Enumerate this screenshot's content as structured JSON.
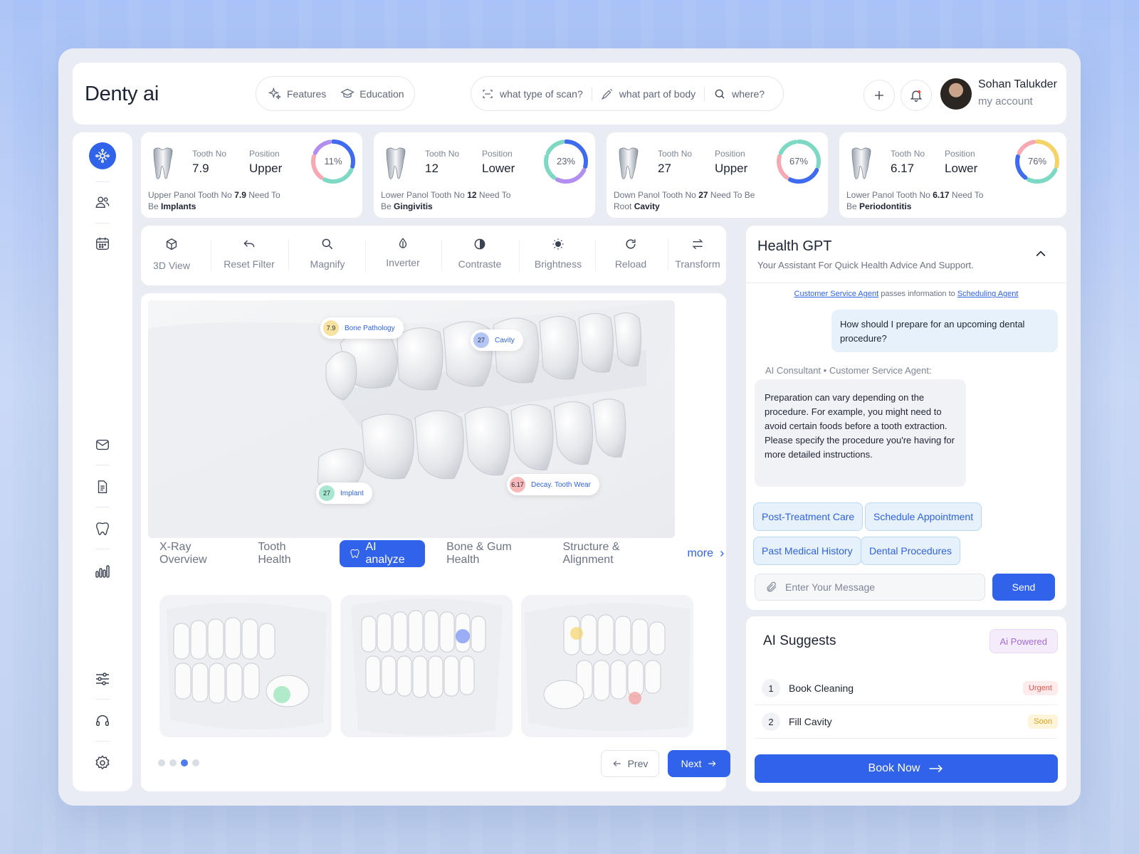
{
  "app": {
    "title": "Denty ai"
  },
  "header": {
    "nav": [
      {
        "label": "Features",
        "icon": "sparkles-icon"
      },
      {
        "label": "Education",
        "icon": "graduation-cap-icon"
      }
    ],
    "search": [
      {
        "label": "what type of scan?",
        "icon": "scan-icon"
      },
      {
        "label": "what part of body",
        "icon": "syringe-icon"
      },
      {
        "label": "where?",
        "icon": "search-icon"
      }
    ],
    "user": {
      "name": "Sohan Talukder",
      "subtitle": "my account"
    }
  },
  "tooth_cards": [
    {
      "tooth_label": "Tooth No",
      "tooth_no": "7.9",
      "position_label": "Position",
      "position": "Upper",
      "percent_text": "11%",
      "percent": 11,
      "desc_prefix": "Upper Panol Tooth No",
      "desc_num": "7.9",
      "desc_mid": "Need To Be",
      "desc_cond": "Implants",
      "ring_colors": [
        "#3f6bf0",
        "#7dd9c3",
        "#f7a8b3",
        "#b28ef0"
      ]
    },
    {
      "tooth_label": "Tooth No",
      "tooth_no": "12",
      "position_label": "Position",
      "position": "Lower",
      "percent_text": "23%",
      "percent": 23,
      "desc_prefix": "Lower Panol Tooth No",
      "desc_num": "12",
      "desc_mid": "Need To Be",
      "desc_cond": "Gingivitis",
      "ring_colors": [
        "#3f6bf0",
        "#b28ef0",
        "#7dd9c3",
        "#7dd9c3"
      ]
    },
    {
      "tooth_label": "Tooth No",
      "tooth_no": "27",
      "position_label": "Position",
      "position": "Upper",
      "percent_text": "67%",
      "percent": 67,
      "desc_prefix": "Down Panol Tooth No",
      "desc_num": "27",
      "desc_mid": "Need To Be Root",
      "desc_cond": "Cavity",
      "ring_colors": [
        "#7dd9c3",
        "#3f6bf0",
        "#f7a8b3",
        "#7dd9c3"
      ]
    },
    {
      "tooth_label": "Tooth No",
      "tooth_no": "6.17",
      "position_label": "Position",
      "position": "Lower",
      "percent_text": "76%",
      "percent": 76,
      "desc_prefix": "Lower Panol Tooth No",
      "desc_num": "6.17",
      "desc_mid": "Need To Be",
      "desc_cond": "Periodontitis",
      "ring_colors": [
        "#f5d36b",
        "#7dd9c3",
        "#3f6bf0",
        "#f7a8b3"
      ]
    }
  ],
  "toolbar": [
    {
      "label": "3D View",
      "icon": "3d-view-icon"
    },
    {
      "label": "Reset Filter",
      "icon": "undo-icon"
    },
    {
      "label": "Magnify",
      "icon": "magnify-icon"
    },
    {
      "label": "Inverter",
      "icon": "inverter-icon"
    },
    {
      "label": "Contraste",
      "icon": "contrast-icon"
    },
    {
      "label": "Brightness",
      "icon": "brightness-icon"
    },
    {
      "label": "Reload",
      "icon": "reload-icon"
    },
    {
      "label": "Transform",
      "icon": "transform-icon"
    }
  ],
  "scan_tags": [
    {
      "num": "7.9",
      "label": "Bone Pathology",
      "color": "#f7e3a0"
    },
    {
      "num": "27",
      "label": "Cavity",
      "color": "#b4c6f6"
    },
    {
      "num": "27",
      "label": "Implant",
      "color": "#a8e6cf"
    },
    {
      "num": "6.17",
      "label": "Decay. Tooth Wear",
      "color": "#f6b8b8"
    }
  ],
  "view_tabs": {
    "items": [
      "X-Ray Overview",
      "Tooth Health",
      "AI analyze",
      "Bone & Gum Health",
      "Structure & Alignment"
    ],
    "active": "AI analyze",
    "more": "more"
  },
  "pagination": {
    "prev": "Prev",
    "next": "Next",
    "total_dots": 4,
    "active_dot": 3
  },
  "health_gpt": {
    "title": "Health GPT",
    "subtitle": "Your Assistant For Quick Health Advice And Support.",
    "route_from": "Customer Service Agent",
    "route_mid": "passes information to",
    "route_to": "Scheduling Agent",
    "user_message": "How should I prepare for an upcoming dental procedure?",
    "ai_label": "AI Consultant • Customer Service Agent:",
    "ai_message": "Preparation can vary depending on the procedure. For example, you might need to avoid certain foods before a tooth extraction. Please specify the procedure you're having for more detailed instructions.",
    "chips": [
      "Post-Treatment Care",
      "Schedule Appointment",
      "Past Medical History",
      "Dental Procedures"
    ],
    "input_placeholder": "Enter Your Message",
    "send": "Send"
  },
  "ai_suggests": {
    "title": "AI Suggests",
    "badge": "Ai Powered",
    "items": [
      {
        "num": "1",
        "label": "Book Cleaning",
        "tag": "Urgent",
        "tag_color": "#e6554f",
        "tag_bg": "#fdeceb"
      },
      {
        "num": "2",
        "label": "Fill Cavity",
        "tag": "Soon",
        "tag_color": "#d9a21b",
        "tag_bg": "#fdf4d9"
      }
    ],
    "cta": "Book Now"
  },
  "colors": {
    "accent": "#3162ea",
    "background": "#e9edf3"
  }
}
